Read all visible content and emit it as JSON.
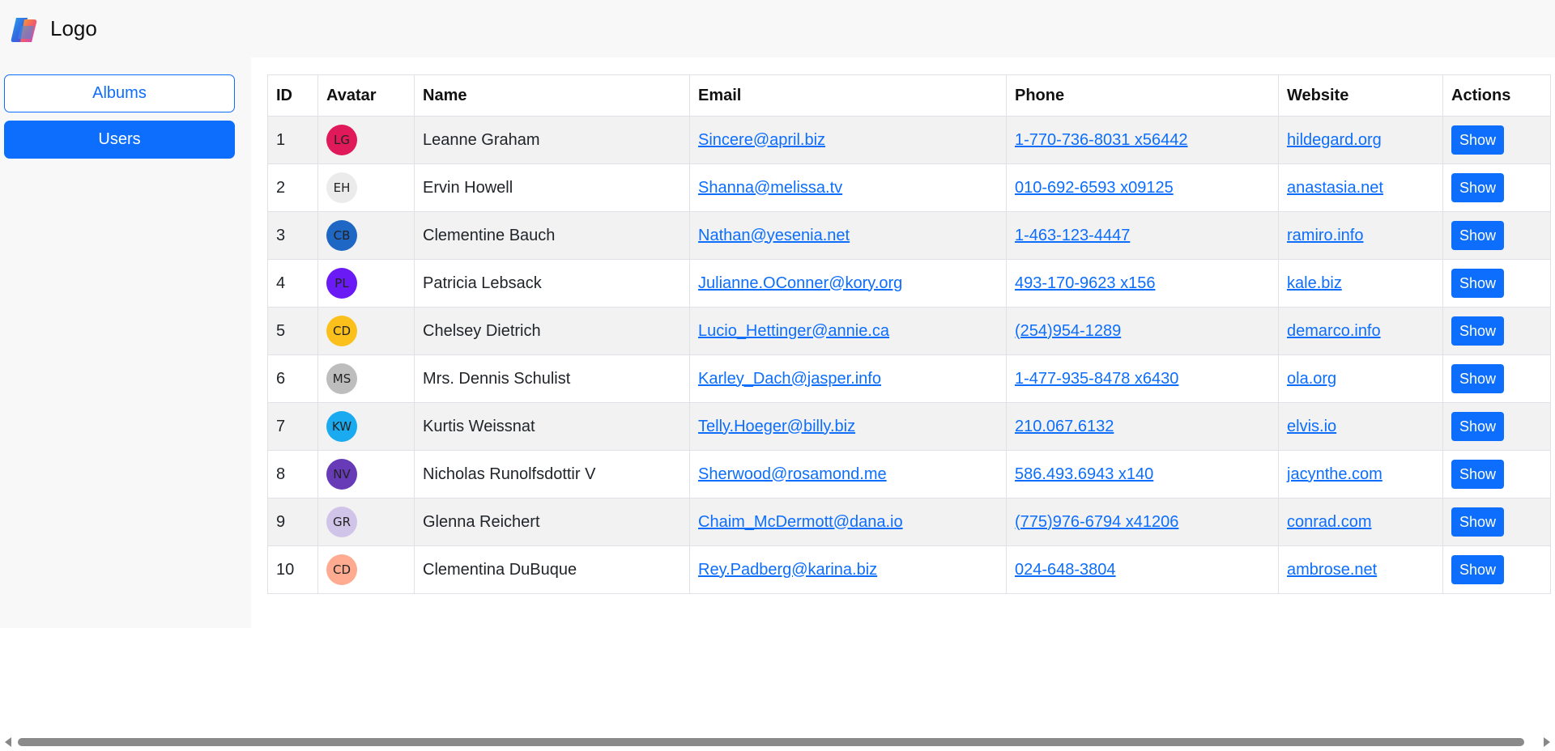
{
  "header": {
    "logo_text": "Logo",
    "logo_icon": "copilot-logo-icon"
  },
  "sidebar": {
    "items": [
      {
        "label": "Albums",
        "active": false
      },
      {
        "label": "Users",
        "active": true
      }
    ]
  },
  "colors": {
    "accent": "#0d6efd",
    "sidebar_bg": "#f8f8f8",
    "stripe": "#f2f2f2"
  },
  "table": {
    "columns": [
      "ID",
      "Avatar",
      "Name",
      "Email",
      "Phone",
      "Website",
      "Actions"
    ],
    "action_label": "Show",
    "rows": [
      {
        "id": "1",
        "initials": "LG",
        "avatar_color": "#e0195a",
        "name": "Leanne Graham",
        "email": "Sincere@april.biz",
        "phone": "1-770-736-8031 x56442",
        "website": "hildegard.org"
      },
      {
        "id": "2",
        "initials": "EH",
        "avatar_color": "#ebebeb",
        "name": "Ervin Howell",
        "email": "Shanna@melissa.tv",
        "phone": "010-692-6593 x09125",
        "website": "anastasia.net"
      },
      {
        "id": "3",
        "initials": "CB",
        "avatar_color": "#1f67c4",
        "name": "Clementine Bauch",
        "email": "Nathan@yesenia.net",
        "phone": "1-463-123-4447",
        "website": "ramiro.info"
      },
      {
        "id": "4",
        "initials": "PL",
        "avatar_color": "#6a1bf5",
        "name": "Patricia Lebsack",
        "email": "Julianne.OConner@kory.org",
        "phone": "493-170-9623 x156",
        "website": "kale.biz"
      },
      {
        "id": "5",
        "initials": "CD",
        "avatar_color": "#fbc01b",
        "name": "Chelsey Dietrich",
        "email": "Lucio_Hettinger@annie.ca",
        "phone": "(254)954-1289",
        "website": "demarco.info"
      },
      {
        "id": "6",
        "initials": "MS",
        "avatar_color": "#bdbdbd",
        "name": "Mrs. Dennis Schulist",
        "email": "Karley_Dach@jasper.info",
        "phone": "1-477-935-8478 x6430",
        "website": "ola.org"
      },
      {
        "id": "7",
        "initials": "KW",
        "avatar_color": "#1aaaf0",
        "name": "Kurtis Weissnat",
        "email": "Telly.Hoeger@billy.biz",
        "phone": "210.067.6132",
        "website": "elvis.io"
      },
      {
        "id": "8",
        "initials": "NV",
        "avatar_color": "#673ab7",
        "name": "Nicholas Runolfsdottir V",
        "email": "Sherwood@rosamond.me",
        "phone": "586.493.6943 x140",
        "website": "jacynthe.com"
      },
      {
        "id": "9",
        "initials": "GR",
        "avatar_color": "#d1c4e9",
        "name": "Glenna Reichert",
        "email": "Chaim_McDermott@dana.io",
        "phone": "(775)976-6794 x41206",
        "website": "conrad.com"
      },
      {
        "id": "10",
        "initials": "CD",
        "avatar_color": "#ffab91",
        "name": "Clementina DuBuque",
        "email": "Rey.Padberg@karina.biz",
        "phone": "024-648-3804",
        "website": "ambrose.net"
      }
    ]
  }
}
